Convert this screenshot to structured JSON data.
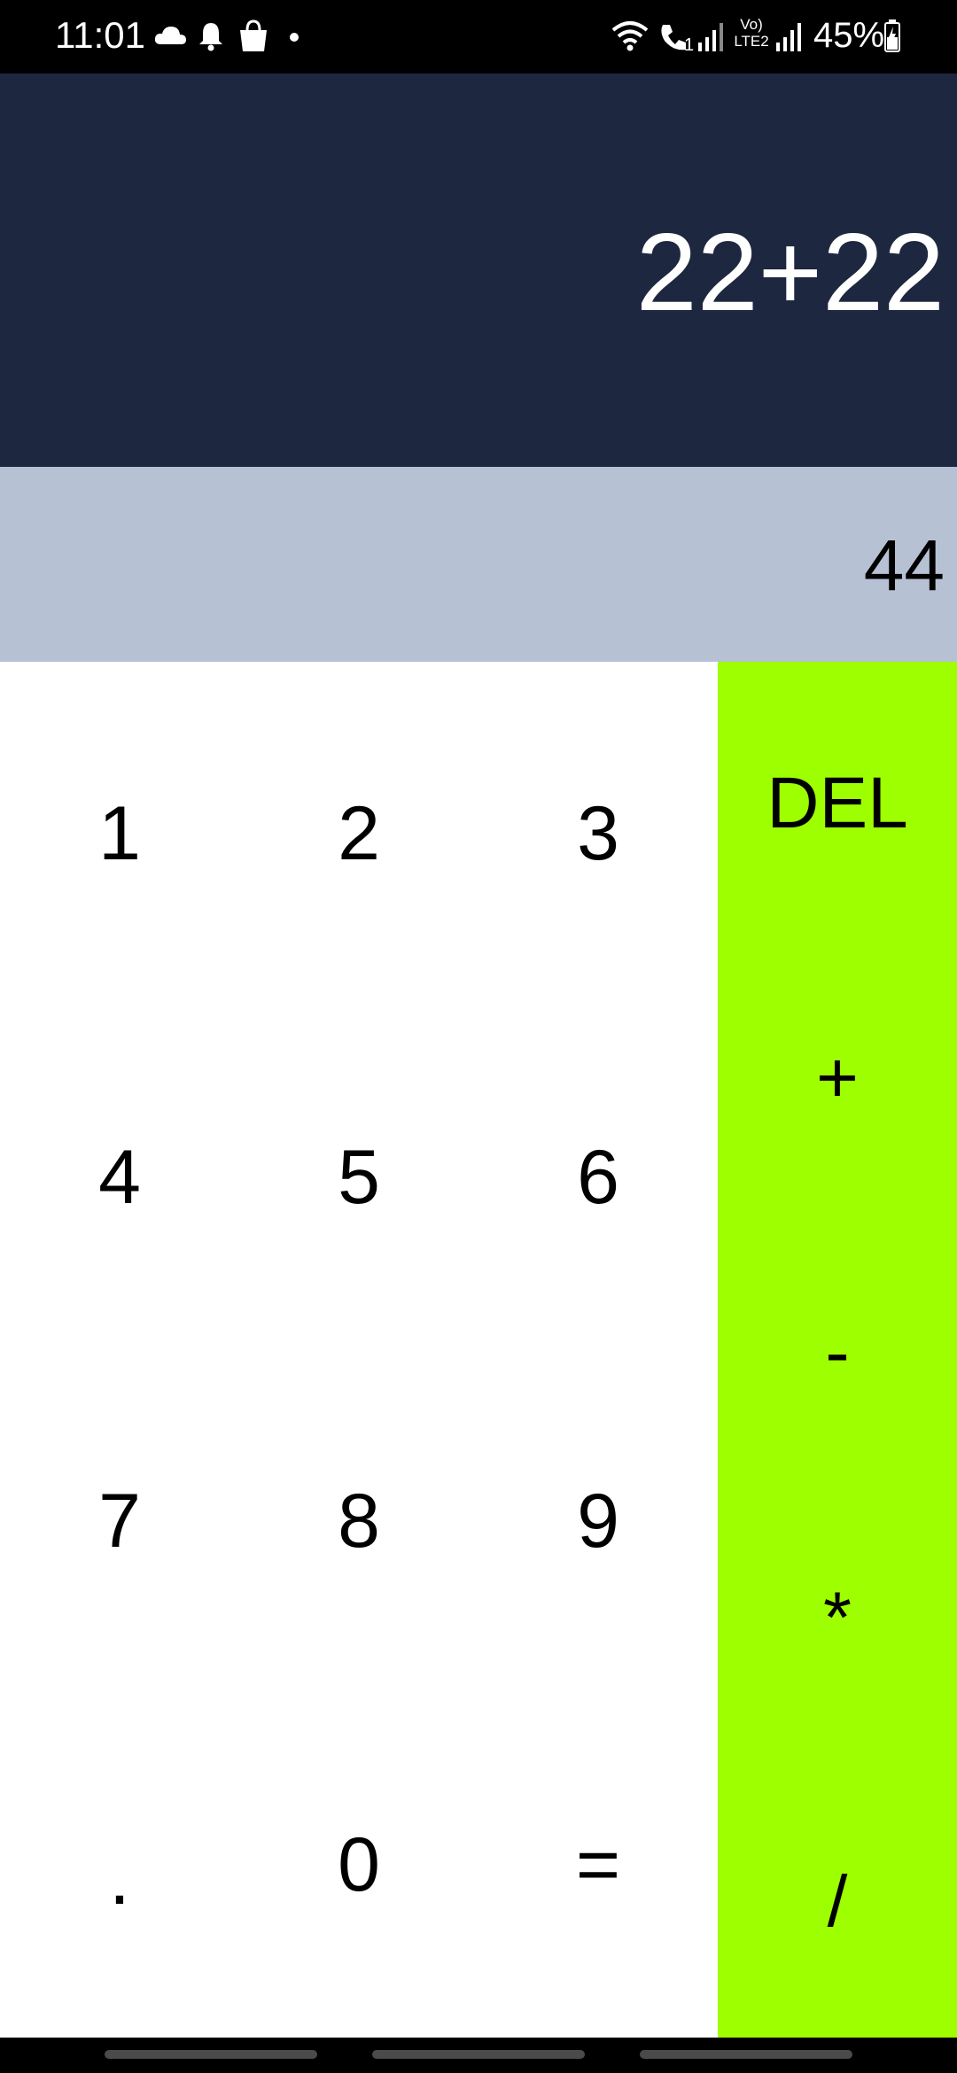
{
  "status_bar": {
    "time": "11:01",
    "battery": "45%",
    "icons": [
      "cloud-icon",
      "bell-icon",
      "shopping-bag-icon",
      "dot-icon",
      "wifi-icon",
      "wifi-calling-icon",
      "signal-icon",
      "volte-icon",
      "signal-icon",
      "battery-icon"
    ],
    "volte_line1": "Vo)",
    "volte_line2": "LTE2",
    "calling_sub": "1"
  },
  "display": {
    "expression": "22+22",
    "result": "44"
  },
  "keypad": {
    "keys": [
      "1",
      "2",
      "3",
      "4",
      "5",
      "6",
      "7",
      "8",
      "9",
      ".",
      "0",
      "="
    ]
  },
  "operators": {
    "del": "DEL",
    "plus": "+",
    "minus": "-",
    "multiply": "*",
    "divide": "/"
  },
  "colors": {
    "expression_bg": "#1e2740",
    "result_bg": "#b7c1d4",
    "operator_bg": "#9eff00",
    "keypad_bg": "#ffffff"
  }
}
